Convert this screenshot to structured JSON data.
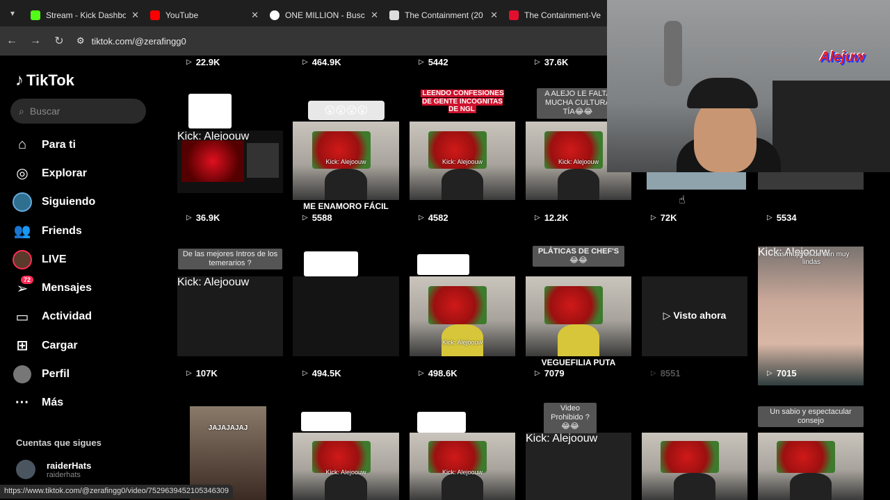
{
  "browser": {
    "tabs": [
      {
        "title": "Stream - Kick Dashbo",
        "color": "#53fc18",
        "letter": "K"
      },
      {
        "title": "YouTube",
        "color": "#ff0000",
        "letter": "▶"
      },
      {
        "title": "ONE MILLION - Busc",
        "color": "#4285f4",
        "letter": "G"
      },
      {
        "title": "The Containment (20",
        "color": "#ffffff",
        "letter": "h"
      },
      {
        "title": "The Containment-Ve",
        "color": "#e0102e",
        "letter": "L"
      }
    ],
    "url": "tiktok.com/@zerafingg0",
    "status_url": "https://www.tiktok.com/@zerafingg0/video/7529639452105346309"
  },
  "sidebar": {
    "logo": "TikTok",
    "search_placeholder": "Buscar",
    "items": [
      {
        "label": "Para ti",
        "icon": "home-icon"
      },
      {
        "label": "Explorar",
        "icon": "compass-icon"
      },
      {
        "label": "Siguiendo",
        "icon": "following-icon"
      },
      {
        "label": "Friends",
        "icon": "friends-icon"
      },
      {
        "label": "LIVE",
        "icon": "live-icon"
      },
      {
        "label": "Mensajes",
        "icon": "messages-icon",
        "badge": "72"
      },
      {
        "label": "Actividad",
        "icon": "activity-icon"
      },
      {
        "label": "Cargar",
        "icon": "upload-icon"
      },
      {
        "label": "Perfil",
        "icon": "profile-icon"
      },
      {
        "label": "Más",
        "icon": "more-icon"
      }
    ],
    "following_title": "Cuentas que sigues",
    "following": {
      "name": "raiderHats",
      "handle": "raiderhats"
    }
  },
  "grid": {
    "row0_counts": [
      "22.9K",
      "464.9K",
      "5442",
      "37.6K"
    ],
    "row1_counts": [
      "36.9K",
      "5588",
      "4582",
      "12.2K",
      "72K",
      "5534"
    ],
    "row2_counts": [
      "107K",
      "494.5K",
      "498.6K",
      "7079",
      "8551",
      "7015"
    ],
    "overlays": {
      "confesiones": "LEENDO CONFESIONES DE GENTE INCOGNITAS DE NGL",
      "alejo_cultura": "A ALEJO LE FALTA MUCHA CULTURA TÍA😂😂",
      "enamoro": "ME ENAMORO FÁCIL",
      "mejores_intros": "De las mejores Intros de los temerarios ?",
      "platicas": "PLÁTICAS DE CHEF'S 😂😂",
      "veguefilia": "VEGUEFILIA PUTA",
      "visto_ahora": "Visto ahora",
      "mujeres": "Las mujeres de son muy lindas",
      "video_prohibido": "Video Prohibido ?😂😂",
      "sabio": "Un sabio y espectacular consejo",
      "jajajajaj": "JAJAJAJAJ",
      "watermark": "Kick: Alejoouw",
      "emojis": "😮😮😮😮"
    }
  },
  "webcam": {
    "brand": "Alejuw"
  }
}
